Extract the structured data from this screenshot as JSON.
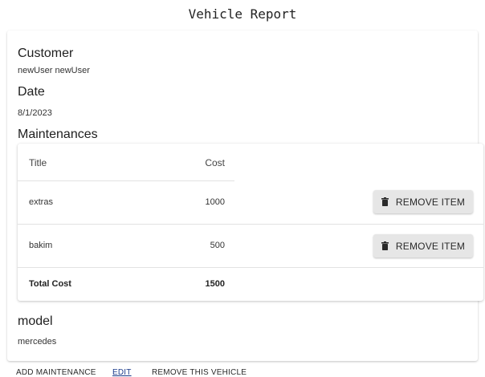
{
  "page": {
    "title": "Vehicle Report"
  },
  "customer": {
    "heading": "Customer",
    "value": "newUser newUser"
  },
  "date": {
    "heading": "Date",
    "value": "8/1/2023"
  },
  "maintenances": {
    "heading": "Maintenances",
    "columns": {
      "title": "Title",
      "cost": "Cost"
    },
    "rows": [
      {
        "title": "extras",
        "cost": "1000",
        "action_label": "REMOVE ITEM"
      },
      {
        "title": "bakim",
        "cost": "500",
        "action_label": "REMOVE ITEM"
      }
    ],
    "total": {
      "label": "Total Cost",
      "value": "1500"
    }
  },
  "model": {
    "heading": "model",
    "value": "mercedes"
  },
  "actions": {
    "add_maintenance": "ADD MAINTENANCE",
    "edit": "EDIT",
    "remove_vehicle": "REMOVE THIS VEHICLE"
  },
  "icons": {
    "remove": "trash-icon"
  }
}
